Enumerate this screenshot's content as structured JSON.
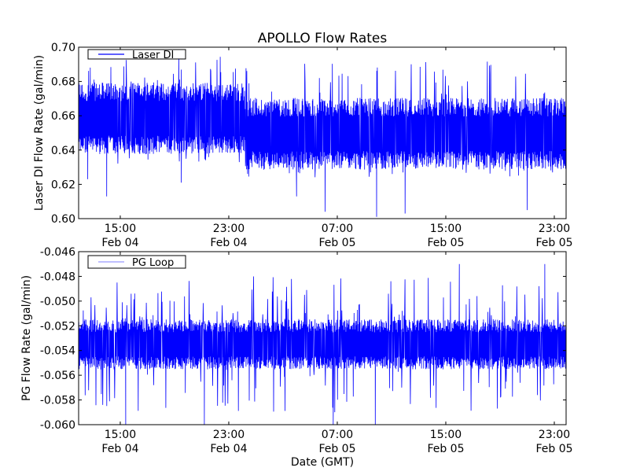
{
  "chart_data": [
    {
      "type": "line",
      "title": "APOLLO Flow Rates",
      "xlabel": "",
      "ylabel": "Laser DI Flow Rate (gal/min)",
      "x_unit": "hours since Feb 04 12:00 GMT",
      "xlim": [
        -0.07,
        35.87
      ],
      "ylim": [
        0.6,
        0.7
      ],
      "yticks": [
        0.6,
        0.62,
        0.64,
        0.66,
        0.68,
        0.7
      ],
      "ytick_labels": [
        "0.60",
        "0.62",
        "0.64",
        "0.66",
        "0.68",
        "0.70"
      ],
      "xticks": [
        3,
        11,
        19,
        27,
        35
      ],
      "xtick_labels": [
        [
          "15:00",
          "Feb 04"
        ],
        [
          "23:00",
          "Feb 04"
        ],
        [
          "07:00",
          "Feb 05"
        ],
        [
          "15:00",
          "Feb 05"
        ],
        [
          "23:00",
          "Feb 05"
        ]
      ],
      "legend": {
        "placement": "top-left",
        "entries": [
          "Laser DI"
        ]
      },
      "series": [
        {
          "name": "Laser DI",
          "color": "#0000ff",
          "segments": [
            {
              "x_range": [
                -0.07,
                12.2
              ],
              "band": [
                0.643,
                0.674
              ],
              "spike_high": 0.696,
              "spike_low": 0.632
            },
            {
              "x_range": [
                12.2,
                35.87
              ],
              "band": [
                0.634,
                0.665
              ],
              "spike_high": 0.694,
              "spike_low": 0.624
            }
          ],
          "notable_points": [
            [
              2.0,
              0.613
            ],
            [
              18.1,
              0.604
            ],
            [
              21.9,
              0.601
            ],
            [
              24.0,
              0.603
            ],
            [
              33.0,
              0.605
            ],
            [
              0.6,
              0.623
            ],
            [
              7.5,
              0.621
            ],
            [
              16.0,
              0.613
            ]
          ]
        }
      ]
    },
    {
      "type": "line",
      "title": "",
      "xlabel": "Date (GMT)",
      "ylabel": "PG Flow Rate (gal/min)",
      "x_unit": "hours since Feb 04 12:00 GMT",
      "xlim": [
        -0.07,
        35.87
      ],
      "ylim": [
        -0.06,
        -0.046
      ],
      "yticks": [
        -0.06,
        -0.058,
        -0.056,
        -0.054,
        -0.052,
        -0.05,
        -0.048,
        -0.046
      ],
      "ytick_labels": [
        "-0.060",
        "-0.058",
        "-0.056",
        "-0.054",
        "-0.052",
        "-0.050",
        "-0.048",
        "-0.046"
      ],
      "xticks": [
        3,
        11,
        19,
        27,
        35
      ],
      "xtick_labels": [
        [
          "15:00",
          "Feb 04"
        ],
        [
          "23:00",
          "Feb 04"
        ],
        [
          "07:00",
          "Feb 05"
        ],
        [
          "15:00",
          "Feb 05"
        ],
        [
          "23:00",
          "Feb 05"
        ]
      ],
      "legend": {
        "placement": "top-left",
        "entries": [
          "PG Loop"
        ]
      },
      "series": [
        {
          "name": "PG Loop",
          "color": "#0000ff",
          "legend_color": "#9999ff",
          "segments": [
            {
              "x_range": [
                -0.07,
                35.87
              ],
              "band": [
                -0.055,
                -0.052
              ],
              "spike_high": -0.048,
              "spike_low": -0.059
            }
          ],
          "notable_points": [
            [
              3.4,
              -0.06
            ],
            [
              9.2,
              -0.06
            ],
            [
              18.7,
              -0.06
            ],
            [
              21.8,
              -0.06
            ],
            [
              34.3,
              -0.047
            ],
            [
              28.0,
              -0.047
            ]
          ]
        }
      ]
    }
  ]
}
